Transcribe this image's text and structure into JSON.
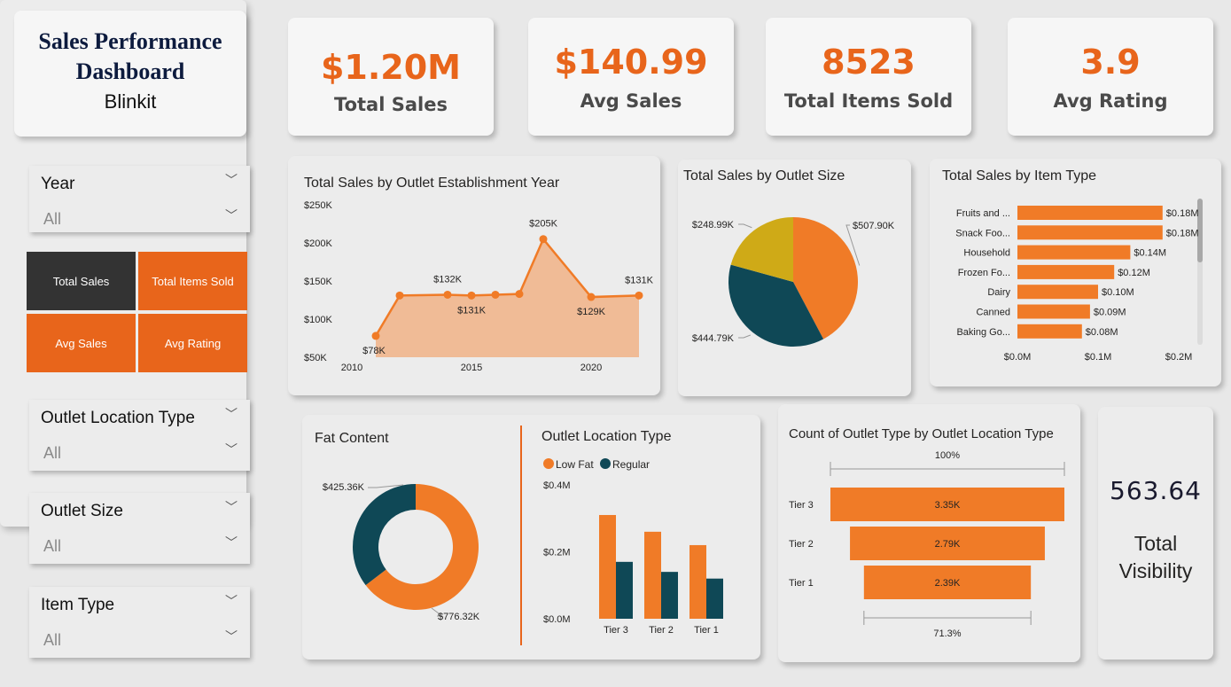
{
  "title": {
    "line1": "Sales  Performance",
    "line2": "Dashboard",
    "subtitle": "Blinkit"
  },
  "kpis": [
    {
      "value": "$1.20M",
      "label": "Total Sales"
    },
    {
      "value": "$140.99",
      "label": "Avg Sales"
    },
    {
      "value": "8523",
      "label": "Total Items Sold"
    },
    {
      "value": "3.9",
      "label": "Avg Rating"
    }
  ],
  "slicers": {
    "year": {
      "label": "Year",
      "value": "All"
    },
    "outlet_location_type": {
      "label": "Outlet Location Type",
      "value": "All"
    },
    "outlet_size": {
      "label": "Outlet Size",
      "value": "All"
    },
    "item_type": {
      "label": "Item Type",
      "value": "All"
    }
  },
  "measure_buttons": {
    "total_sales": "Total Sales",
    "total_items_sold": "Total Items Sold",
    "avg_sales": "Avg Sales",
    "avg_rating": "Avg Rating",
    "selected": "Total Sales"
  },
  "colors": {
    "orange": "#F07B27",
    "teal": "#0F4856",
    "mustard": "#CFAA17",
    "accent": "#E8651B",
    "dark_button": "#333333"
  },
  "icons": {
    "dropdown": "chevron-down-icon"
  },
  "visibility": {
    "value": "563.64",
    "label": "Total Visibility"
  },
  "chart_data": [
    {
      "type": "area",
      "title": "Total Sales by Outlet Establishment Year",
      "x": [
        2011,
        2012,
        2014,
        2015,
        2016,
        2017,
        2018,
        2020,
        2022
      ],
      "y": [
        78,
        131,
        132,
        131,
        132,
        133,
        205,
        129,
        131
      ],
      "point_labels": [
        "$78K",
        "",
        "$132K",
        "$131K",
        "",
        "",
        "$205K",
        "$129K",
        "$131K"
      ],
      "y_ticks": [
        "$50K",
        "$100K",
        "$150K",
        "$200K",
        "$250K"
      ],
      "x_ticks": [
        "2010",
        "2015",
        "2020"
      ],
      "ylim": [
        50,
        250
      ],
      "xlim": [
        2010,
        2022
      ],
      "y_unit": "$K"
    },
    {
      "type": "pie",
      "title": "Total Sales by Outlet Size",
      "slices": [
        {
          "label": "$507.90K",
          "value": 507.9,
          "color": "#F07B27"
        },
        {
          "label": "$444.79K",
          "value": 444.79,
          "color": "#0F4856"
        },
        {
          "label": "$248.99K",
          "value": 248.99,
          "color": "#CFAA17"
        }
      ]
    },
    {
      "type": "bar",
      "title": "Total Sales by Item Type",
      "orientation": "horizontal",
      "categories": [
        "Fruits and ...",
        "Snack Foo...",
        "Household",
        "Frozen Fo...",
        "Dairy",
        "Canned",
        "Baking Go..."
      ],
      "values": [
        0.18,
        0.18,
        0.14,
        0.12,
        0.1,
        0.09,
        0.08
      ],
      "value_labels": [
        "$0.18M",
        "$0.18M",
        "$0.14M",
        "$0.12M",
        "$0.10M",
        "$0.09M",
        "$0.08M"
      ],
      "x_ticks": [
        "$0.0M",
        "$0.1M",
        "$0.2M"
      ],
      "xlim": [
        0,
        0.2
      ]
    },
    {
      "type": "pie",
      "subtype": "donut",
      "title": "Fat Content",
      "slices": [
        {
          "label": "$776.32K",
          "value": 776.32,
          "color": "#F07B27"
        },
        {
          "label": "$425.36K",
          "value": 425.36,
          "color": "#0F4856"
        }
      ]
    },
    {
      "type": "bar",
      "title": "Outlet Location Type",
      "categories": [
        "Tier 3",
        "Tier 2",
        "Tier 1"
      ],
      "series": [
        {
          "name": "Low Fat",
          "values": [
            0.31,
            0.26,
            0.22
          ],
          "color": "#F07B27"
        },
        {
          "name": "Regular",
          "values": [
            0.17,
            0.14,
            0.12
          ],
          "color": "#0F4856"
        }
      ],
      "y_ticks": [
        "$0.0M",
        "$0.2M",
        "$0.4M"
      ],
      "ylim": [
        0,
        0.4
      ]
    },
    {
      "type": "bar",
      "subtype": "funnel",
      "title": "Count of Outlet Type by Outlet Location Type",
      "categories": [
        "Tier 3",
        "Tier 2",
        "Tier 1"
      ],
      "values": [
        3350,
        2790,
        2390
      ],
      "value_labels": [
        "3.35K",
        "2.79K",
        "2.39K"
      ],
      "top_label": "100%",
      "bottom_label": "71.3%"
    }
  ]
}
